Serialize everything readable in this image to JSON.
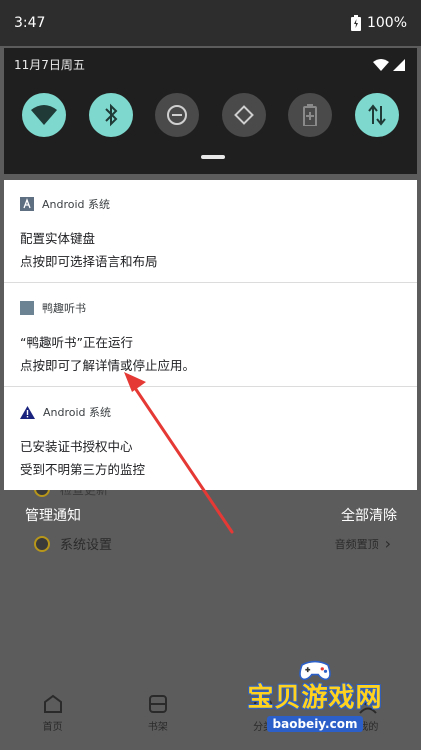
{
  "status_bar": {
    "time": "3:47",
    "battery": "100%"
  },
  "quick_settings": {
    "date": "11月7日周五",
    "tiles": [
      {
        "name": "wifi",
        "state": "on"
      },
      {
        "name": "bluetooth",
        "state": "on"
      },
      {
        "name": "do-not-disturb",
        "state": "off"
      },
      {
        "name": "auto-rotate",
        "state": "off"
      },
      {
        "name": "battery-saver",
        "state": "off"
      },
      {
        "name": "mobile-data",
        "state": "on"
      }
    ]
  },
  "notifications": [
    {
      "app": "Android 系统",
      "title": "配置实体键盘",
      "text": "点按即可选择语言和布局"
    },
    {
      "app": "鸭趣听书",
      "title": "“鸭趣听书”正在运行",
      "text": "点按即可了解详情或停止应用。"
    },
    {
      "app": "Android 系统",
      "title": "已安装证书授权中心",
      "text": "受到不明第三方的监控"
    }
  ],
  "footer": {
    "manage": "管理通知",
    "clear_all": "全部清除"
  },
  "background": {
    "peek_label": "检查更新",
    "settings_label": "系统设置",
    "settings_value": "音频置顶"
  },
  "bottom_nav": [
    "首页",
    "书架",
    "分类",
    "我的"
  ],
  "watermark": {
    "title": "宝贝游戏网",
    "url": "baobeiy.com"
  },
  "colors": {
    "accent": "#7ed8cd",
    "arrow": "#e53935"
  }
}
